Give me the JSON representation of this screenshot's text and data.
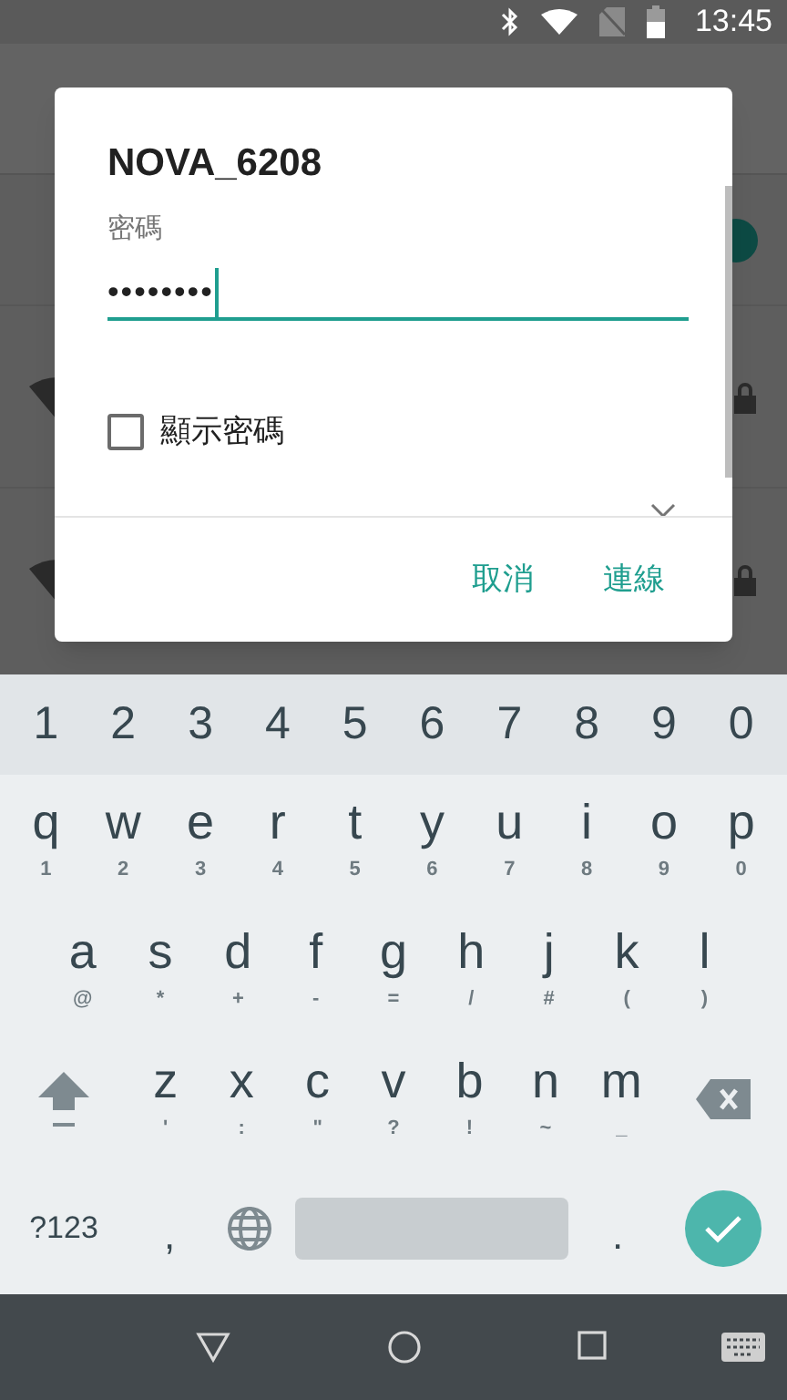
{
  "status_bar": {
    "time": "13:45"
  },
  "dialog": {
    "title": "NOVA_6208",
    "password": {
      "label": "密碼",
      "value": "••••••••"
    },
    "show_password": {
      "label": "顯示密碼",
      "checked": false
    },
    "advanced": {
      "expanded": false
    },
    "buttons": [
      "取消",
      "連線"
    ]
  },
  "keyboard": {
    "number_row": [
      "1",
      "2",
      "3",
      "4",
      "5",
      "6",
      "7",
      "8",
      "9",
      "0"
    ],
    "rows": [
      [
        {
          "kind": "letter",
          "label": "q",
          "hint": "1"
        },
        {
          "kind": "letter",
          "label": "w",
          "hint": "2"
        },
        {
          "kind": "letter",
          "label": "e",
          "hint": "3"
        },
        {
          "kind": "letter",
          "label": "r",
          "hint": "4"
        },
        {
          "kind": "letter",
          "label": "t",
          "hint": "5"
        },
        {
          "kind": "letter",
          "label": "y",
          "hint": "6"
        },
        {
          "kind": "letter",
          "label": "u",
          "hint": "7"
        },
        {
          "kind": "letter",
          "label": "i",
          "hint": "8"
        },
        {
          "kind": "letter",
          "label": "o",
          "hint": "9"
        },
        {
          "kind": "letter",
          "label": "p",
          "hint": "0"
        }
      ],
      [
        {
          "kind": "letter",
          "label": "a",
          "hint": "@"
        },
        {
          "kind": "letter",
          "label": "s",
          "hint": "*"
        },
        {
          "kind": "letter",
          "label": "d",
          "hint": "+"
        },
        {
          "kind": "letter",
          "label": "f",
          "hint": "-"
        },
        {
          "kind": "letter",
          "label": "g",
          "hint": "="
        },
        {
          "kind": "letter",
          "label": "h",
          "hint": "/"
        },
        {
          "kind": "letter",
          "label": "j",
          "hint": "#"
        },
        {
          "kind": "letter",
          "label": "k",
          "hint": "("
        },
        {
          "kind": "letter",
          "label": "l",
          "hint": ")"
        }
      ],
      [
        {
          "kind": "shift"
        },
        {
          "kind": "letter",
          "label": "z",
          "hint": "'"
        },
        {
          "kind": "letter",
          "label": "x",
          "hint": ":"
        },
        {
          "kind": "letter",
          "label": "c",
          "hint": "\""
        },
        {
          "kind": "letter",
          "label": "v",
          "hint": "?"
        },
        {
          "kind": "letter",
          "label": "b",
          "hint": "!"
        },
        {
          "kind": "letter",
          "label": "n",
          "hint": "~"
        },
        {
          "kind": "letter",
          "label": "m",
          "hint": "_"
        },
        {
          "kind": "backspace"
        }
      ],
      [
        {
          "kind": "symbols",
          "label": "?123"
        },
        {
          "kind": "char",
          "label": ","
        },
        {
          "kind": "globe"
        },
        {
          "kind": "space"
        },
        {
          "kind": "char",
          "label": "."
        },
        {
          "kind": "enter"
        }
      ]
    ]
  }
}
